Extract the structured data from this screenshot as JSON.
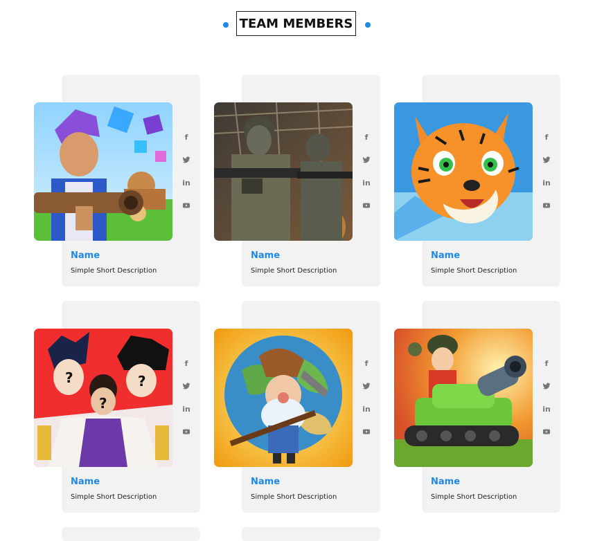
{
  "section": {
    "title": "TEAM MEMBERS",
    "accent_color": "#1e88e5"
  },
  "members": [
    {
      "name": "Name",
      "description": "Simple Short Description",
      "image": "cartoon boy with bazooka and cubes"
    },
    {
      "name": "Name",
      "description": "Simple Short Description",
      "image": "soldiers with rifles in hangar"
    },
    {
      "name": "Name",
      "description": "Simple Short Description",
      "image": "cartoon tiger"
    },
    {
      "name": "Name",
      "description": "Simple Short Description",
      "image": "anime characters with question marks"
    },
    {
      "name": "Name",
      "description": "Simple Short Description",
      "image": "old miner with pickaxe and globe"
    },
    {
      "name": "Name",
      "description": "Simple Short Description",
      "image": "cartoon soldier on green tank"
    }
  ],
  "social_icons": [
    "facebook-icon",
    "twitter-icon",
    "linkedin-icon",
    "youtube-icon"
  ]
}
